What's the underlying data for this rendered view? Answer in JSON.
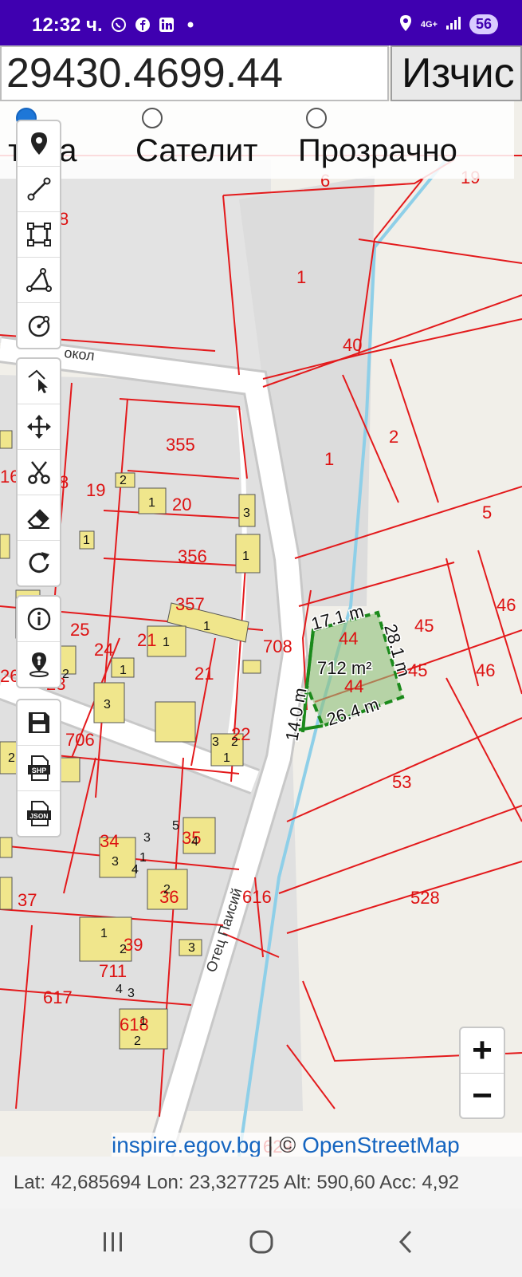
{
  "status_bar": {
    "time": "12:32 ч.",
    "notification_icons": [
      "viber-icon",
      "facebook-icon",
      "linkedin-icon",
      "dot-icon"
    ],
    "network": "4G+",
    "battery": "56"
  },
  "toolbar": {
    "coordinate_value": "29430.4699.44",
    "calculate_button": "Изчис"
  },
  "layer_options": {
    "options": [
      "Карта",
      "Сателит",
      "Прозрачно"
    ],
    "selected": "Карта",
    "visible_labels": [
      "ърта",
      "Сателит",
      "Прозрачно"
    ]
  },
  "tools": {
    "group1": [
      "marker-icon",
      "line-icon",
      "polygon-icon",
      "angle-icon",
      "circle-icon"
    ],
    "group2": [
      "select-edit-icon",
      "move-icon",
      "cut-icon",
      "eraser-icon",
      "undo-icon"
    ],
    "group3": [
      "info-icon",
      "location-pin-icon"
    ],
    "group4": [
      "save-icon",
      "shp-export-icon",
      "json-export-icon"
    ],
    "shp_label": "SHP",
    "json_label": "JSON"
  },
  "map": {
    "parcel_labels": [
      "1",
      "40",
      "2",
      "1",
      "5",
      "355",
      "19",
      "20",
      "356",
      "357",
      "708",
      "25",
      "21",
      "24",
      "21",
      "23",
      "706",
      "22",
      "53",
      "34",
      "35",
      "36",
      "37",
      "616",
      "528",
      "39",
      "711",
      "617",
      "618",
      "46",
      "46",
      "45",
      "45",
      "6",
      "19",
      "8",
      "16",
      "8",
      "26",
      "44",
      "44",
      "629"
    ],
    "building_labels": [
      "1",
      "2",
      "3",
      "1",
      "1",
      "1",
      "2",
      "3",
      "1",
      "1",
      "3",
      "2",
      "1",
      "2",
      "3",
      "4",
      "5",
      "3",
      "1",
      "4",
      "2",
      "3",
      "1",
      "2",
      "4",
      "3",
      "1",
      "2"
    ],
    "street_name": "Отец Паисий",
    "partial_street": "окол",
    "measurement": {
      "area": "712 m²",
      "top": "17.1 m",
      "right": "28.1 m",
      "bottom": "26.4 m",
      "left": "14.0 m"
    }
  },
  "zoom": {
    "in": "+",
    "out": "−"
  },
  "attribution": {
    "source1": "inspire.egov.bg",
    "separator": " | © ",
    "source2": "OpenStreetMap"
  },
  "coordinates": "Lat: 42,685694 Lon: 23,327725 Alt: 590,60 Acc: 4,92",
  "colors": {
    "status_bar": "#3f00b0",
    "parcel_border": "#e31a1c",
    "measurement": "#1b8a1b",
    "building": "#f0e68c",
    "road": "#ffffff",
    "water": "#7ec8e3"
  }
}
